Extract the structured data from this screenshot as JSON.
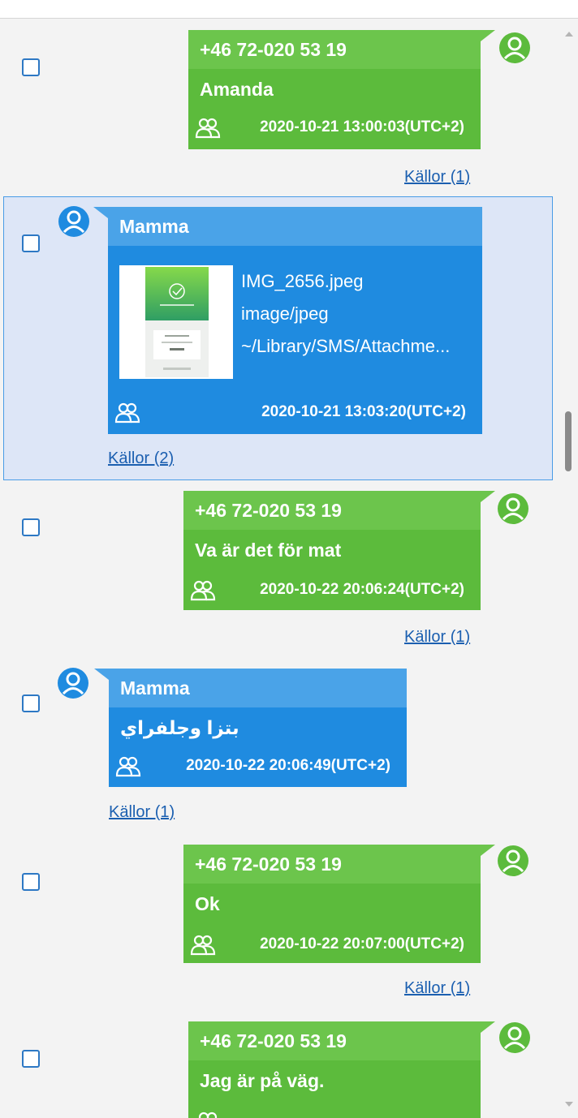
{
  "messages": [
    {
      "sender": "+46 72-020 53 19",
      "text": "Amanda",
      "timestamp": "2020-10-21 13:00:03(UTC+2)",
      "sources": "Källor (1)",
      "direction": "outgoing"
    },
    {
      "sender": "Mamma",
      "attachment": {
        "filename": "IMG_2656.jpeg",
        "mime": "image/jpeg",
        "path": "~/Library/SMS/Attachme..."
      },
      "timestamp": "2020-10-21 13:03:20(UTC+2)",
      "sources": "Källor (2)",
      "direction": "incoming",
      "selected": true
    },
    {
      "sender": "+46 72-020 53 19",
      "text": "Va är det för mat",
      "timestamp": "2020-10-22 20:06:24(UTC+2)",
      "sources": "Källor (1)",
      "direction": "outgoing"
    },
    {
      "sender": "Mamma",
      "text": "بتزا وجلفراي",
      "timestamp": "2020-10-22 20:06:49(UTC+2)",
      "sources": "Källor (1)",
      "direction": "incoming"
    },
    {
      "sender": "+46 72-020 53 19",
      "text": "Ok",
      "timestamp": "2020-10-22 20:07:00(UTC+2)",
      "sources": "Källor (1)",
      "direction": "outgoing"
    },
    {
      "sender": "+46 72-020 53 19",
      "text": "Jag är på väg.",
      "direction": "outgoing"
    }
  ],
  "colors": {
    "outgoing_bubble": "#5cbb3c",
    "outgoing_header": "#6cc54c",
    "incoming_bubble": "#1f8be0",
    "incoming_header": "#4aa3e8",
    "link": "#1b5fb0",
    "selection_border": "#4a9ce6",
    "selection_fill": "#dde6f7"
  },
  "icons": {
    "contact_avatar": "person-circle-icon",
    "participants": "people-outline-icon",
    "scroll_up": "triangle-up-icon",
    "scroll_down": "triangle-down-icon"
  }
}
